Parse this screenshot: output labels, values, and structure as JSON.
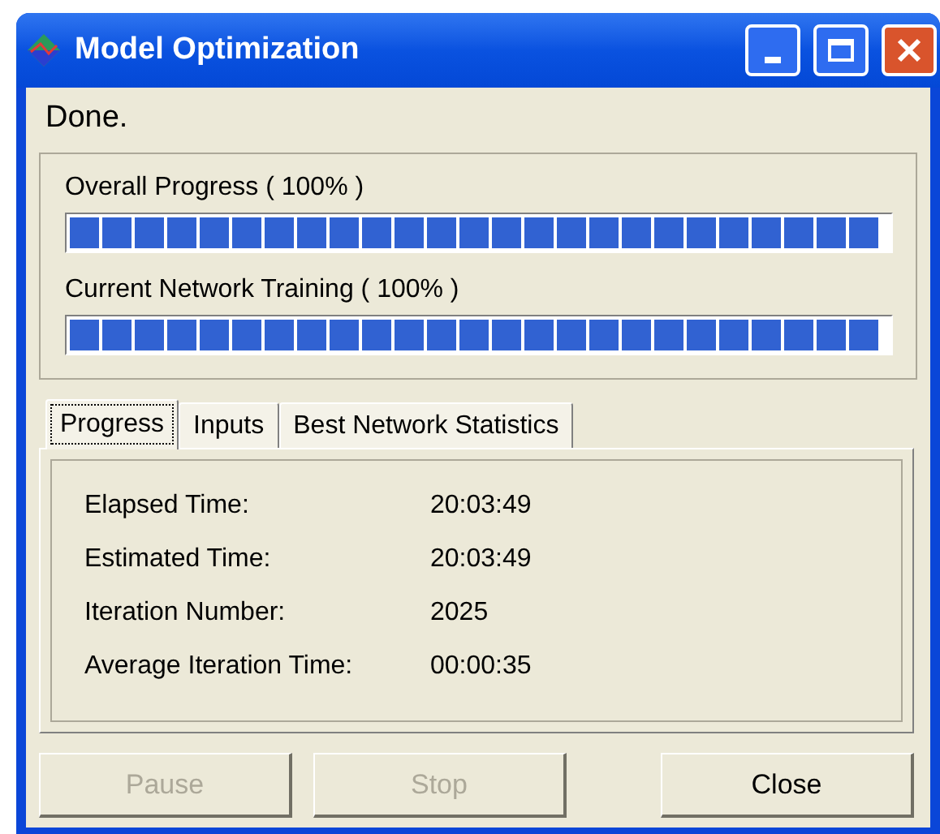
{
  "window": {
    "title": "Model Optimization"
  },
  "status": "Done.",
  "progress_bars": [
    {
      "label": "Overall Progress  ( 100% )",
      "level": 1
    },
    {
      "label": "Current Network Training  ( 100% )",
      "level": 1
    }
  ],
  "tabs": [
    {
      "label": "Progress",
      "selected": true
    },
    {
      "label": "Inputs",
      "selected": false
    },
    {
      "label": "Best Network Statistics",
      "selected": false
    }
  ],
  "stats": [
    {
      "label": "Elapsed Time:",
      "value": "20:03:49"
    },
    {
      "label": "Estimated Time:",
      "value": "20:03:49"
    },
    {
      "label": "Iteration Number:",
      "value": "2025"
    },
    {
      "label": "Average Iteration Time:",
      "value": "00:00:35"
    }
  ],
  "buttons": [
    {
      "label": "Pause",
      "disabled": true
    },
    {
      "label": "Stop",
      "disabled": true
    },
    {
      "label": "Close",
      "disabled": false
    }
  ]
}
